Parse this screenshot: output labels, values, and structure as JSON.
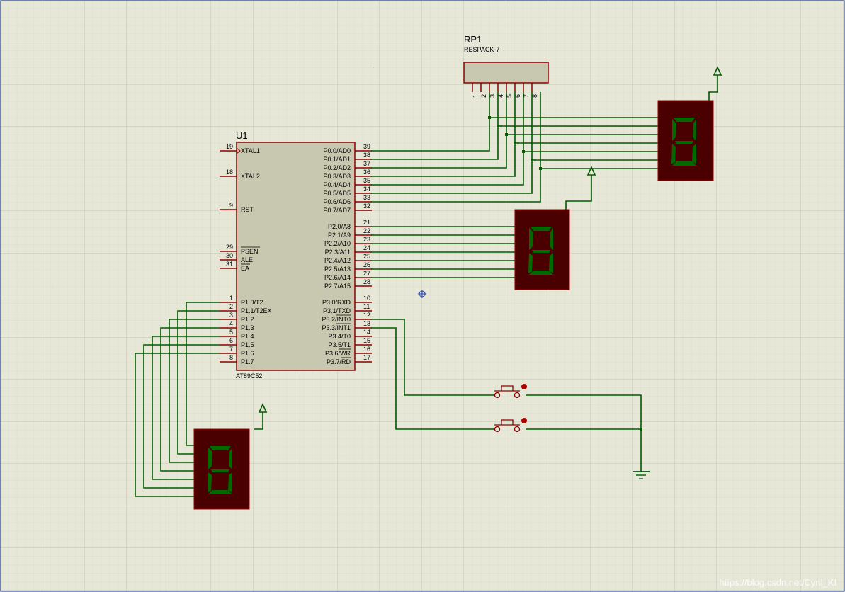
{
  "mcu": {
    "ref": "U1",
    "part": "AT89C52",
    "left_pins": [
      {
        "num": "19",
        "name": "XTAL1"
      },
      {
        "num": "18",
        "name": "XTAL2"
      },
      {
        "num": "9",
        "name": "RST"
      },
      {
        "num": "29",
        "name": "PSEN"
      },
      {
        "num": "30",
        "name": "ALE"
      },
      {
        "num": "31",
        "name": "EA"
      },
      {
        "num": "1",
        "name": "P1.0/T2"
      },
      {
        "num": "2",
        "name": "P1.1/T2EX"
      },
      {
        "num": "3",
        "name": "P1.2"
      },
      {
        "num": "4",
        "name": "P1.3"
      },
      {
        "num": "5",
        "name": "P1.4"
      },
      {
        "num": "6",
        "name": "P1.5"
      },
      {
        "num": "7",
        "name": "P1.6"
      },
      {
        "num": "8",
        "name": "P1.7"
      }
    ],
    "right_pins": [
      {
        "num": "39",
        "name": "P0.0/AD0"
      },
      {
        "num": "38",
        "name": "P0.1/AD1"
      },
      {
        "num": "37",
        "name": "P0.2/AD2"
      },
      {
        "num": "36",
        "name": "P0.3/AD3"
      },
      {
        "num": "35",
        "name": "P0.4/AD4"
      },
      {
        "num": "34",
        "name": "P0.5/AD5"
      },
      {
        "num": "33",
        "name": "P0.6/AD6"
      },
      {
        "num": "32",
        "name": "P0.7/AD7"
      },
      {
        "num": "21",
        "name": "P2.0/A8"
      },
      {
        "num": "22",
        "name": "P2.1/A9"
      },
      {
        "num": "23",
        "name": "P2.2/A10"
      },
      {
        "num": "24",
        "name": "P2.3/A11"
      },
      {
        "num": "25",
        "name": "P2.4/A12"
      },
      {
        "num": "26",
        "name": "P2.5/A13"
      },
      {
        "num": "27",
        "name": "P2.6/A14"
      },
      {
        "num": "28",
        "name": "P2.7/A15"
      },
      {
        "num": "10",
        "name": "P3.0/RXD"
      },
      {
        "num": "11",
        "name": "P3.1/TXD"
      },
      {
        "num": "12",
        "name": "P3.2/INT0"
      },
      {
        "num": "13",
        "name": "P3.3/INT1"
      },
      {
        "num": "14",
        "name": "P3.4/T0"
      },
      {
        "num": "15",
        "name": "P3.5/T1"
      },
      {
        "num": "16",
        "name": "P3.6/WR"
      },
      {
        "num": "17",
        "name": "P3.7/RD"
      }
    ]
  },
  "resistor_pack": {
    "ref": "RP1",
    "part": "RESPACK-7",
    "pins": [
      "1",
      "2",
      "3",
      "4",
      "5",
      "6",
      "7",
      "8"
    ]
  },
  "digit_char": "8",
  "watermark": "https://blog.csdn.net/Cyril_KI",
  "colors": {
    "background": "#e7e7d8",
    "grid": "#cfcfbd",
    "wire": "#005a00",
    "component_outline": "#8b0000",
    "display_body": "#4a0000",
    "segment": "#006000"
  }
}
